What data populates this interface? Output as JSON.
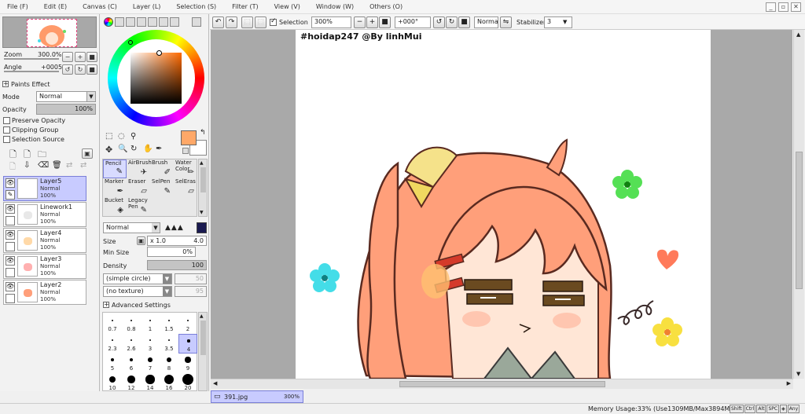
{
  "menu": [
    "File (F)",
    "Edit (E)",
    "Canvas (C)",
    "Layer (L)",
    "Selection (S)",
    "Filter (T)",
    "View (V)",
    "Window (W)",
    "Others (O)"
  ],
  "navigator": {
    "zoom_label": "Zoom",
    "zoom_value": "300.0%",
    "angle_label": "Angle",
    "angle_value": "+0005"
  },
  "layer_panel": {
    "paints_effect": "Paints Effect",
    "mode_label": "Mode",
    "mode_value": "Normal",
    "opacity_label": "Opacity",
    "opacity_value": "100%",
    "preserve_opacity": "Preserve Opacity",
    "clipping_group": "Clipping Group",
    "selection_source": "Selection Source",
    "layers": [
      {
        "name": "Layer5",
        "mode": "Normal",
        "opacity": "100%",
        "selected": true
      },
      {
        "name": "Linework1",
        "mode": "Normal",
        "opacity": "100%",
        "selected": false
      },
      {
        "name": "Layer4",
        "mode": "Normal",
        "opacity": "100%",
        "selected": false
      },
      {
        "name": "Layer3",
        "mode": "Normal",
        "opacity": "100%",
        "selected": false
      },
      {
        "name": "Layer2",
        "mode": "Normal",
        "opacity": "100%",
        "selected": false
      }
    ]
  },
  "colors": {
    "current": "#ffa868",
    "background": "#ffffff",
    "accent_selected": "#c8cbff"
  },
  "tools": [
    {
      "label": "Pencil",
      "icon": "✎",
      "selected": true
    },
    {
      "label": "AirBrush",
      "icon": "✈",
      "selected": false
    },
    {
      "label": "Brush",
      "icon": "✐",
      "selected": false
    },
    {
      "label": "Water Color",
      "icon": "✏",
      "selected": false
    },
    {
      "label": "Marker",
      "icon": "✒",
      "selected": false
    },
    {
      "label": "Eraser",
      "icon": "▱",
      "selected": false
    },
    {
      "label": "SelPen",
      "icon": "✎",
      "selected": false
    },
    {
      "label": "SelEras",
      "icon": "▱",
      "selected": false
    },
    {
      "label": "Bucket",
      "icon": "◈",
      "selected": false
    },
    {
      "label": "Legacy Pen",
      "icon": "✎",
      "selected": false
    }
  ],
  "brush": {
    "blend_mode": "Normal",
    "size_label": "Size",
    "size_mult": "x 1.0",
    "size_value": "4.0",
    "min_size_label": "Min Size",
    "min_size_value": "0%",
    "density_label": "Density",
    "density_value": "100",
    "shape": "(simple circle)",
    "shape_value": "50",
    "texture": "(no texture)",
    "texture_value": "95",
    "advanced": "Advanced Settings",
    "sizes": [
      "0.7",
      "0.8",
      "1",
      "1.5",
      "2",
      "2.3",
      "2.6",
      "3",
      "3.5",
      "4",
      "5",
      "6",
      "7",
      "8",
      "9",
      "10",
      "12",
      "14",
      "16",
      "20"
    ]
  },
  "toolbar": {
    "selection_label": "Selection",
    "zoom": "300%",
    "angle": "+000°",
    "blend": "Normal",
    "stabilizer_label": "Stabilizer",
    "stabilizer_value": "3"
  },
  "canvas": {
    "watermark": "#hoidap247 @By linhMui"
  },
  "document_tab": {
    "name": "391.jpg",
    "zoom": "300%"
  },
  "status": {
    "memory": "Memory Usage:33% (Use1309MB/Max3894MB)",
    "keys": [
      "Shift",
      "Ctrl",
      "Alt",
      "SPC",
      "◈",
      "Any"
    ]
  }
}
